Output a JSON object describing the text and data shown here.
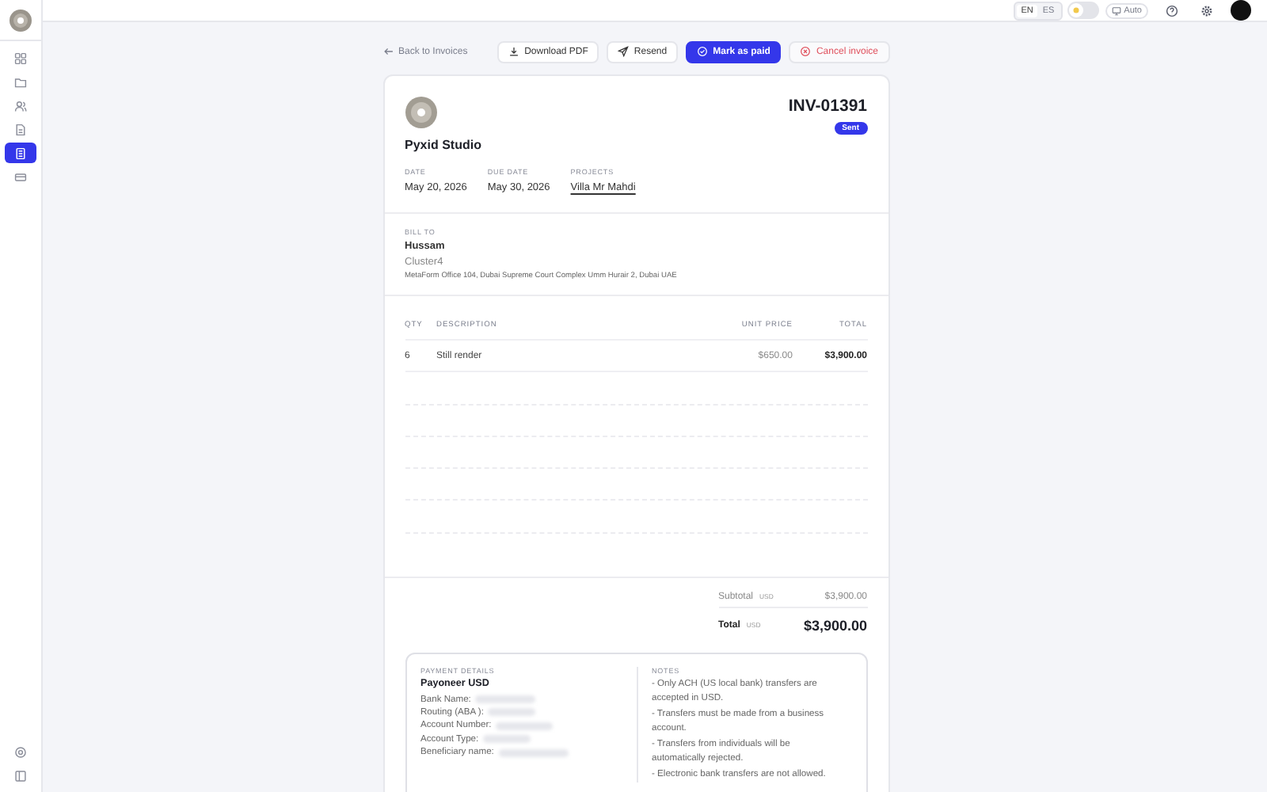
{
  "sidebar": {
    "items": [
      {
        "kind": "grid",
        "selected": false
      },
      {
        "kind": "folder",
        "selected": false
      },
      {
        "kind": "users",
        "selected": false
      },
      {
        "kind": "file",
        "selected": false
      },
      {
        "kind": "invoice",
        "selected": true
      },
      {
        "kind": "card",
        "selected": false
      }
    ],
    "bottom_items": [
      {
        "kind": "help"
      },
      {
        "kind": "panel"
      }
    ]
  },
  "topbar": {
    "languages": [
      {
        "label": "EN",
        "selected": true
      },
      {
        "label": "ES",
        "selected": false
      }
    ],
    "theme_dark": false,
    "display_mode": "Auto"
  },
  "toolbar": {
    "back": "Back to Invoices",
    "buttons": [
      {
        "kind": "download",
        "label": "Download PDF"
      },
      {
        "kind": "resend",
        "label": "Resend"
      },
      {
        "kind": "primary",
        "label": "Mark as paid"
      },
      {
        "kind": "danger",
        "label": "Cancel invoice"
      }
    ]
  },
  "invoice": {
    "company": "Pyxid Studio",
    "number": "INV-01391",
    "status": "Sent",
    "meta": [
      {
        "label": "DATE",
        "value": "May 20, 2026",
        "link": false
      },
      {
        "label": "DUE DATE",
        "value": "May 30, 2026",
        "link": false
      },
      {
        "label": "PROJECTS",
        "value": "Villa Mr Mahdi",
        "link": true
      }
    ],
    "bill_to": {
      "heading": "BILL TO",
      "name": "Hussam",
      "company": "Cluster4",
      "address": "MetaForm Office 104, Dubai Supreme Court Complex Umm Hurair 2, Dubai UAE"
    },
    "table": {
      "columns": [
        "QTY",
        "DESCRIPTION",
        "UNIT PRICE",
        "TOTAL"
      ],
      "rows": [
        [
          "6",
          "Still render",
          "$650.00",
          "$3,900.00"
        ]
      ]
    },
    "subtotal": {
      "label": "Subtotal",
      "currency": "USD",
      "value": "$3,900.00"
    },
    "total": {
      "label": "Total",
      "currency": "USD",
      "value": "$3,900.00"
    },
    "payment": {
      "heading": "PAYMENT DETAILS",
      "title": "Payoneer USD",
      "fields": [
        "Bank Name:",
        "Routing (ABA ):",
        "Account Number:",
        "Account Type:",
        "Beneficiary name:"
      ]
    },
    "notes": {
      "heading": "NOTES",
      "lines": [
        "- Only ACH (US local bank) transfers are accepted in USD.",
        "- Transfers must be made from a business account.",
        "- Transfers from individuals will be automatically rejected.",
        "- Electronic bank transfers are not allowed."
      ]
    }
  }
}
